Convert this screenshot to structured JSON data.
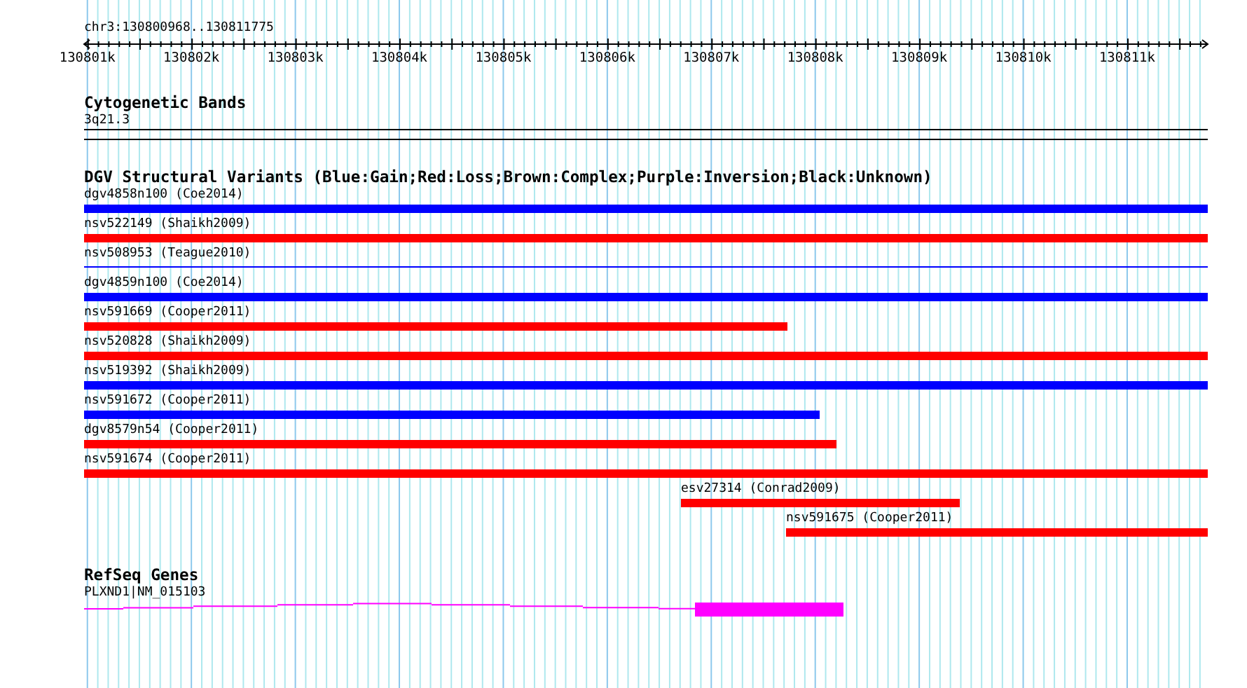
{
  "ruler": {
    "region": "chr3:130800968..130811775",
    "ticks": [
      "130801k",
      "130802k",
      "130803k",
      "130804k",
      "130805k",
      "130806k",
      "130807k",
      "130808k",
      "130809k",
      "130810k",
      "130811k"
    ]
  },
  "tracks": [
    {
      "kind": "cytoband",
      "title": "Cytogenetic Bands",
      "features": [
        {
          "label": "3q21.3"
        }
      ]
    },
    {
      "kind": "variants",
      "title": "DGV Structural Variants (Blue:Gain;Red:Loss;Brown:Complex;Purple:Inversion;Black:Unknown)",
      "features": [
        {
          "label": "dgv4858n100 (Coe2014)",
          "color": "#0000ff",
          "kind": "bar"
        },
        {
          "label": "nsv522149 (Shaikh2009)",
          "color": "#ff0000",
          "kind": "bar"
        },
        {
          "label": "nsv508953 (Teague2010)",
          "color": "#0000ff",
          "kind": "line"
        },
        {
          "label": "dgv4859n100 (Coe2014)",
          "color": "#0000ff",
          "kind": "bar"
        },
        {
          "label": "nsv591669 (Cooper2011)",
          "color": "#ff0000",
          "kind": "bar"
        },
        {
          "label": "nsv520828 (Shaikh2009)",
          "color": "#ff0000",
          "kind": "bar"
        },
        {
          "label": "nsv519392 (Shaikh2009)",
          "color": "#0000ff",
          "kind": "bar"
        },
        {
          "label": "nsv591672 (Cooper2011)",
          "color": "#0000ff",
          "kind": "bar"
        },
        {
          "label": "dgv8579n54 (Cooper2011)",
          "color": "#ff0000",
          "kind": "bar"
        },
        {
          "label": "nsv591674 (Cooper2011)",
          "color": "#ff0000",
          "kind": "bar"
        },
        {
          "label": "esv27314 (Conrad2009)",
          "color": "#ff0000",
          "kind": "bar"
        },
        {
          "label": "nsv591675 (Cooper2011)",
          "color": "#ff0000",
          "kind": "bar"
        }
      ]
    },
    {
      "kind": "genes",
      "title": "RefSeq Genes",
      "features": [
        {
          "label": "PLXND1|NM_015103",
          "color": "#ff00ff"
        }
      ]
    }
  ]
}
